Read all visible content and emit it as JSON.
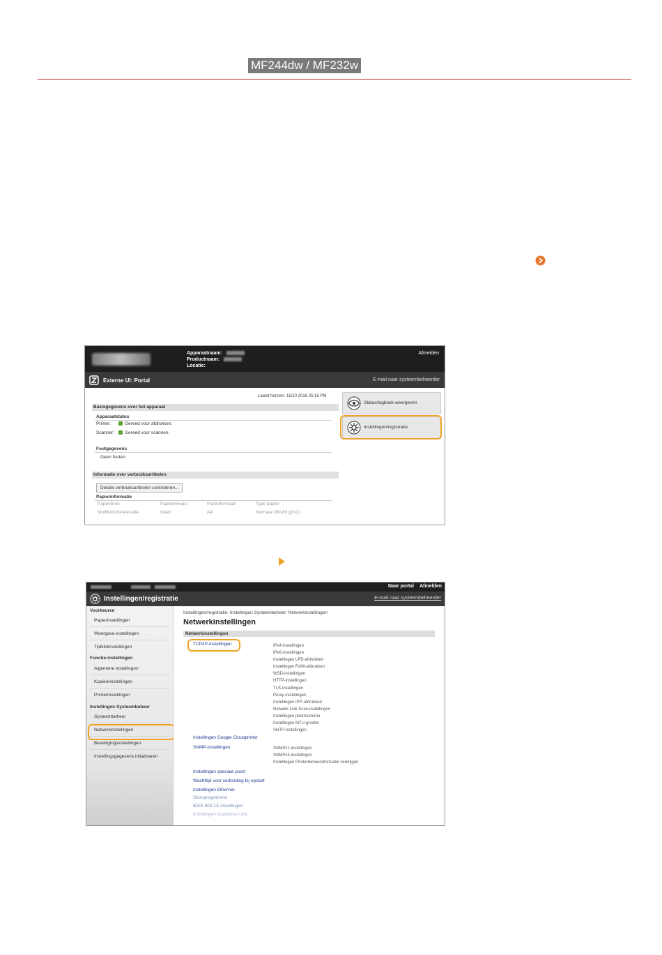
{
  "header": {
    "model": "MF244dw / MF232w"
  },
  "screenshot1": {
    "labels": {
      "device_name": "Apparaatnaam:",
      "product_name": "Productnaam:",
      "location": "Locatie:"
    },
    "logout": "Afmelden",
    "portal_title": "Externe UI: Portal",
    "mail_admin": "E-mail naar systeembeheerder",
    "last_updated": "Laatst herzien: 15/10 2016 05:16 PM",
    "section_basic": "Basisgegevens over het apparaat",
    "device_status": "Apparaatstatus",
    "printer_label": "Printer:",
    "printer_status": "Gereed voor afdrukken.",
    "scanner_label": "Scanner:",
    "scanner_status": "Gereed voor scannen.",
    "error_info": "Foutgegevens",
    "no_errors": "Geen fouten.",
    "section_consumables": "Informatie over verbruiksartikelen",
    "check_button": "Details verbruiksartikelen controleren...",
    "paper_info": "Papierinformatie",
    "table_headers": [
      "Papierbron",
      "Papierniveau",
      "Papierformaat",
      "Type papier"
    ],
    "table_row": [
      "Multifunctionele lade",
      "Geen",
      "A4",
      "Normaal (60-89 g/m2)"
    ],
    "panel_status": "Status/logboek weergeven",
    "panel_settings": "Instellingen/registratie"
  },
  "screenshot2": {
    "portal_link": "Naar portal",
    "logout": "Afmelden",
    "title": "Instellingen/registratie",
    "mail_admin": "E-mail naar systeembeheerder",
    "sidebar": {
      "cat_preferences": "Voorkeuren",
      "paper": "Papierinstellingen",
      "display": "Weergave-instellingen",
      "timer": "Tijdklokinstellingen",
      "cat_function": "Functie-instellingen",
      "general": "Algemene instellingen",
      "copy": "Kopieerinstellingen",
      "printer": "Printerinstellingen",
      "cat_system": "Instellingen Systeembeheer",
      "sysadmin": "Systeembeheer",
      "network": "Netwerkinstellingen",
      "security": "Beveiligingsinstellingen",
      "init": "Instellingsgegevens initialiseren"
    },
    "breadcrumb": "Instellingen/registratie: Instellingen Systeembeheer: Netwerkinstellingen",
    "heading": "Netwerkinstellingen",
    "section": "Netwerkinstellingen",
    "tcpip_link": "TCP/IP-instellingen",
    "tcpip_items": [
      "IPv4-instellingen",
      "IPv6-instellingen",
      "Instellingen LPD-afdrukken",
      "Instellingen RAW-afdrukken",
      "WSD-instellingen",
      "HTTP-instellingen",
      "TLS-instellingen",
      "Proxy-instellingen",
      "Instellingen IPP-afdrukken",
      "Netwerk Link Scan-instellingen",
      "Instellingen poortnummer",
      "Instellingen MTU-grootte",
      "SNTP-instellingen"
    ],
    "cloud_link": "Instellingen Google Cloudprinter",
    "snmp_link": "SNMP-instellingen",
    "snmp_items": [
      "SNMPv1-instellingen",
      "SNMPv3-instellingen",
      "Instellingen Printerbeheerinformatie verkrijgen"
    ],
    "dedicated_port_link": "Instellingen speciale poort",
    "waittime_link": "Wachttijd voor verbinding bij opstart",
    "ethernet_link": "Instellingen Ethernet-",
    "stuur_link": "Stuurprogramma",
    "ieee_link": "IEEE 802.1X-instellingen",
    "wlan_link": "Instellingen draadloos LAN"
  },
  "colors": {
    "highlight": "#f0a326",
    "rule": "#b5322c",
    "link": "#1a3d8f"
  }
}
